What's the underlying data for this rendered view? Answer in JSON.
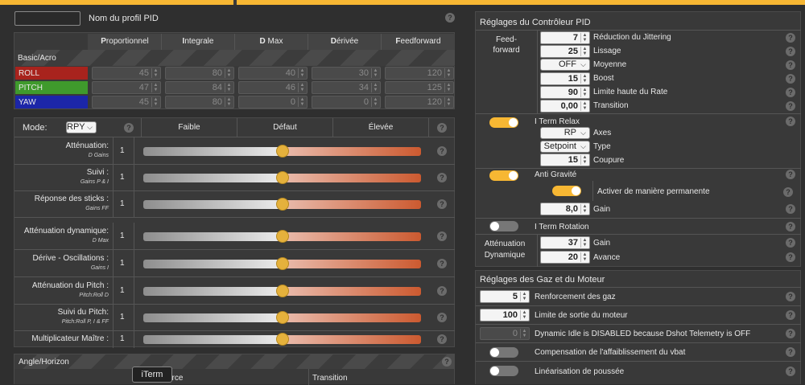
{
  "profile": {
    "name_label": "Nom du profil PID",
    "name_value": ""
  },
  "pid_table": {
    "headers": [
      {
        "bold": "P",
        "rest": "roportionnel"
      },
      {
        "bold": "I",
        "rest": "ntegrale"
      },
      {
        "bold": "D",
        "rest": " Max"
      },
      {
        "bold": "D",
        "rest": "érivée"
      },
      {
        "bold": "F",
        "rest": "eedforward"
      }
    ],
    "group_label": "Basic/Acro",
    "rows": [
      {
        "name": "ROLL",
        "color": "#a8231d",
        "values": [
          "45",
          "80",
          "40",
          "30",
          "120"
        ]
      },
      {
        "name": "PITCH",
        "color": "#3f9a2c",
        "values": [
          "47",
          "84",
          "46",
          "34",
          "125"
        ]
      },
      {
        "name": "YAW",
        "color": "#1c26a8",
        "values": [
          "45",
          "80",
          "0",
          "0",
          "120"
        ]
      }
    ]
  },
  "sliders_panel": {
    "mode_label": "Mode:",
    "mode_value": "RPY",
    "col_low": "Faible",
    "col_default": "Défaut",
    "col_high": "Élevée",
    "rows": [
      {
        "title": "Atténuation:",
        "sub": "D Gains",
        "value": "1"
      },
      {
        "title": "Suivi :",
        "sub": "Gains P & I",
        "value": "1"
      },
      {
        "title": "Réponse des sticks :",
        "sub": "Gains FF",
        "value": "1"
      },
      {
        "title": "Atténuation dynamique:",
        "sub": "D Max",
        "value": "1"
      },
      {
        "title": "Dérive - Oscillations :",
        "sub": "Gains I",
        "value": "1"
      },
      {
        "title": "Atténuation du Pitch :",
        "sub": "Pitch:Roll D",
        "value": "1"
      },
      {
        "title": "Suivi du Pitch:",
        "sub": "Pitch:Roll P, I & FF",
        "value": "1"
      },
      {
        "title": "Multiplicateur Maître :",
        "sub": "",
        "value": "1"
      }
    ]
  },
  "angle_panel": {
    "title": "Angle/Horizon",
    "col_force": "orce",
    "col_transition": "Transition",
    "tooltip": "iTerm"
  },
  "pid_controller": {
    "title": "Réglages du Contrôleur PID",
    "feedforward_label": "Feed-\nforward",
    "feedforward": [
      {
        "value": "7",
        "label": "Réduction du Jittering",
        "type": "spin"
      },
      {
        "value": "25",
        "label": "Lissage",
        "type": "spin"
      },
      {
        "value": "OFF",
        "label": "Moyenne",
        "type": "select"
      },
      {
        "value": "15",
        "label": "Boost",
        "type": "spin"
      },
      {
        "value": "90",
        "label": "Limite haute du Rate",
        "type": "spin"
      },
      {
        "value": "0,00",
        "label": "Transition",
        "type": "spin"
      }
    ],
    "iterm_relax": {
      "title": "I Term Relax",
      "axes_value": "RP",
      "axes_label": "Axes",
      "type_value": "Setpoint",
      "type_label": "Type",
      "cutoff_value": "15",
      "cutoff_label": "Coupure"
    },
    "anti_gravity": {
      "title": "Anti Gravité",
      "permanent_label": "Activer de manière permanente",
      "gain_value": "8,0",
      "gain_label": "Gain"
    },
    "iterm_rotation": {
      "title": "I Term Rotation"
    },
    "dyn_damping": {
      "label": "Atténuation\nDynamique",
      "gain_value": "37",
      "gain_label": "Gain",
      "advance_value": "20",
      "advance_label": "Avance"
    }
  },
  "throttle": {
    "title": "Réglages des Gaz et du Moteur",
    "rows": [
      {
        "value": "5",
        "label": "Renforcement des gaz"
      },
      {
        "value": "100",
        "label": "Limite de sortie du moteur"
      },
      {
        "value": "0",
        "label": "Dynamic Idle is DISABLED because Dshot Telemetry is OFF"
      },
      {
        "label": "Compensation de l'affaiblissement du vbat"
      },
      {
        "label": "Linéarisation de poussée"
      }
    ]
  },
  "colors": {
    "accent": "#f7b733",
    "roll": "#a8231d",
    "pitch": "#3f9a2c",
    "yaw": "#1c26a8"
  }
}
